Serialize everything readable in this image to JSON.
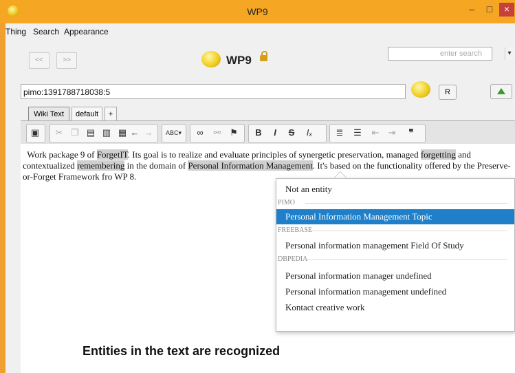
{
  "window": {
    "title": "WP9"
  },
  "menu": [
    "Thing",
    "Search",
    "Appearance"
  ],
  "nav": {
    "back": "<<",
    "forward": ">>"
  },
  "app_title": "WP9",
  "search": {
    "placeholder": "enter search"
  },
  "uri": {
    "value": "pimo:1391788718038:5"
  },
  "buttons": {
    "r": "R"
  },
  "tabs": [
    "Wiki Text",
    "default",
    "+"
  ],
  "editor": {
    "text_parts": [
      "Work package 9 of ",
      "ForgetIT",
      ". Its goal is to realize and evaluate principles of synergetic preservation, managed ",
      "forgetting",
      " and contextualized ",
      "remembering",
      " in the domain of ",
      "Personal Information Management",
      ". It's based on the functionality offered by the Preserve-or-Forget Framework fro",
      "WP 8."
    ]
  },
  "popup": {
    "items": [
      {
        "type": "item",
        "label": "Not an entity"
      },
      {
        "type": "section",
        "label": "PIMO"
      },
      {
        "type": "item",
        "label": "Personal Information Management   Topic",
        "selected": true
      },
      {
        "type": "section",
        "label": "FREEBASE"
      },
      {
        "type": "item",
        "label": "Personal information management   Field Of Study"
      },
      {
        "type": "section",
        "label": "DBPEDIA"
      },
      {
        "type": "item",
        "label": "Personal information manager   undefined"
      },
      {
        "type": "item",
        "label": "Personal information management   undefined"
      },
      {
        "type": "item",
        "label": "Kontact   creative work"
      }
    ]
  },
  "caption": "Entities in the text are recognized",
  "colors": {
    "titlebar": "#f5a623",
    "selection": "#1f7fc8",
    "highlight": "#cfcfcf"
  },
  "icons": [
    "app-icon",
    "wp9-logo-icon",
    "lock-icon",
    "dropdown-arrow-icon",
    "up-arrow-icon",
    "save-icon",
    "cut-icon",
    "copy-icon",
    "paste-icon",
    "undo-icon",
    "redo-icon",
    "spellcheck-icon",
    "link-icon",
    "unlink-icon",
    "flag-icon",
    "bold-icon",
    "italic-icon",
    "strike-icon",
    "clear-format-icon",
    "numbered-list-icon",
    "bullet-list-icon",
    "outdent-icon",
    "indent-icon",
    "quote-icon"
  ]
}
